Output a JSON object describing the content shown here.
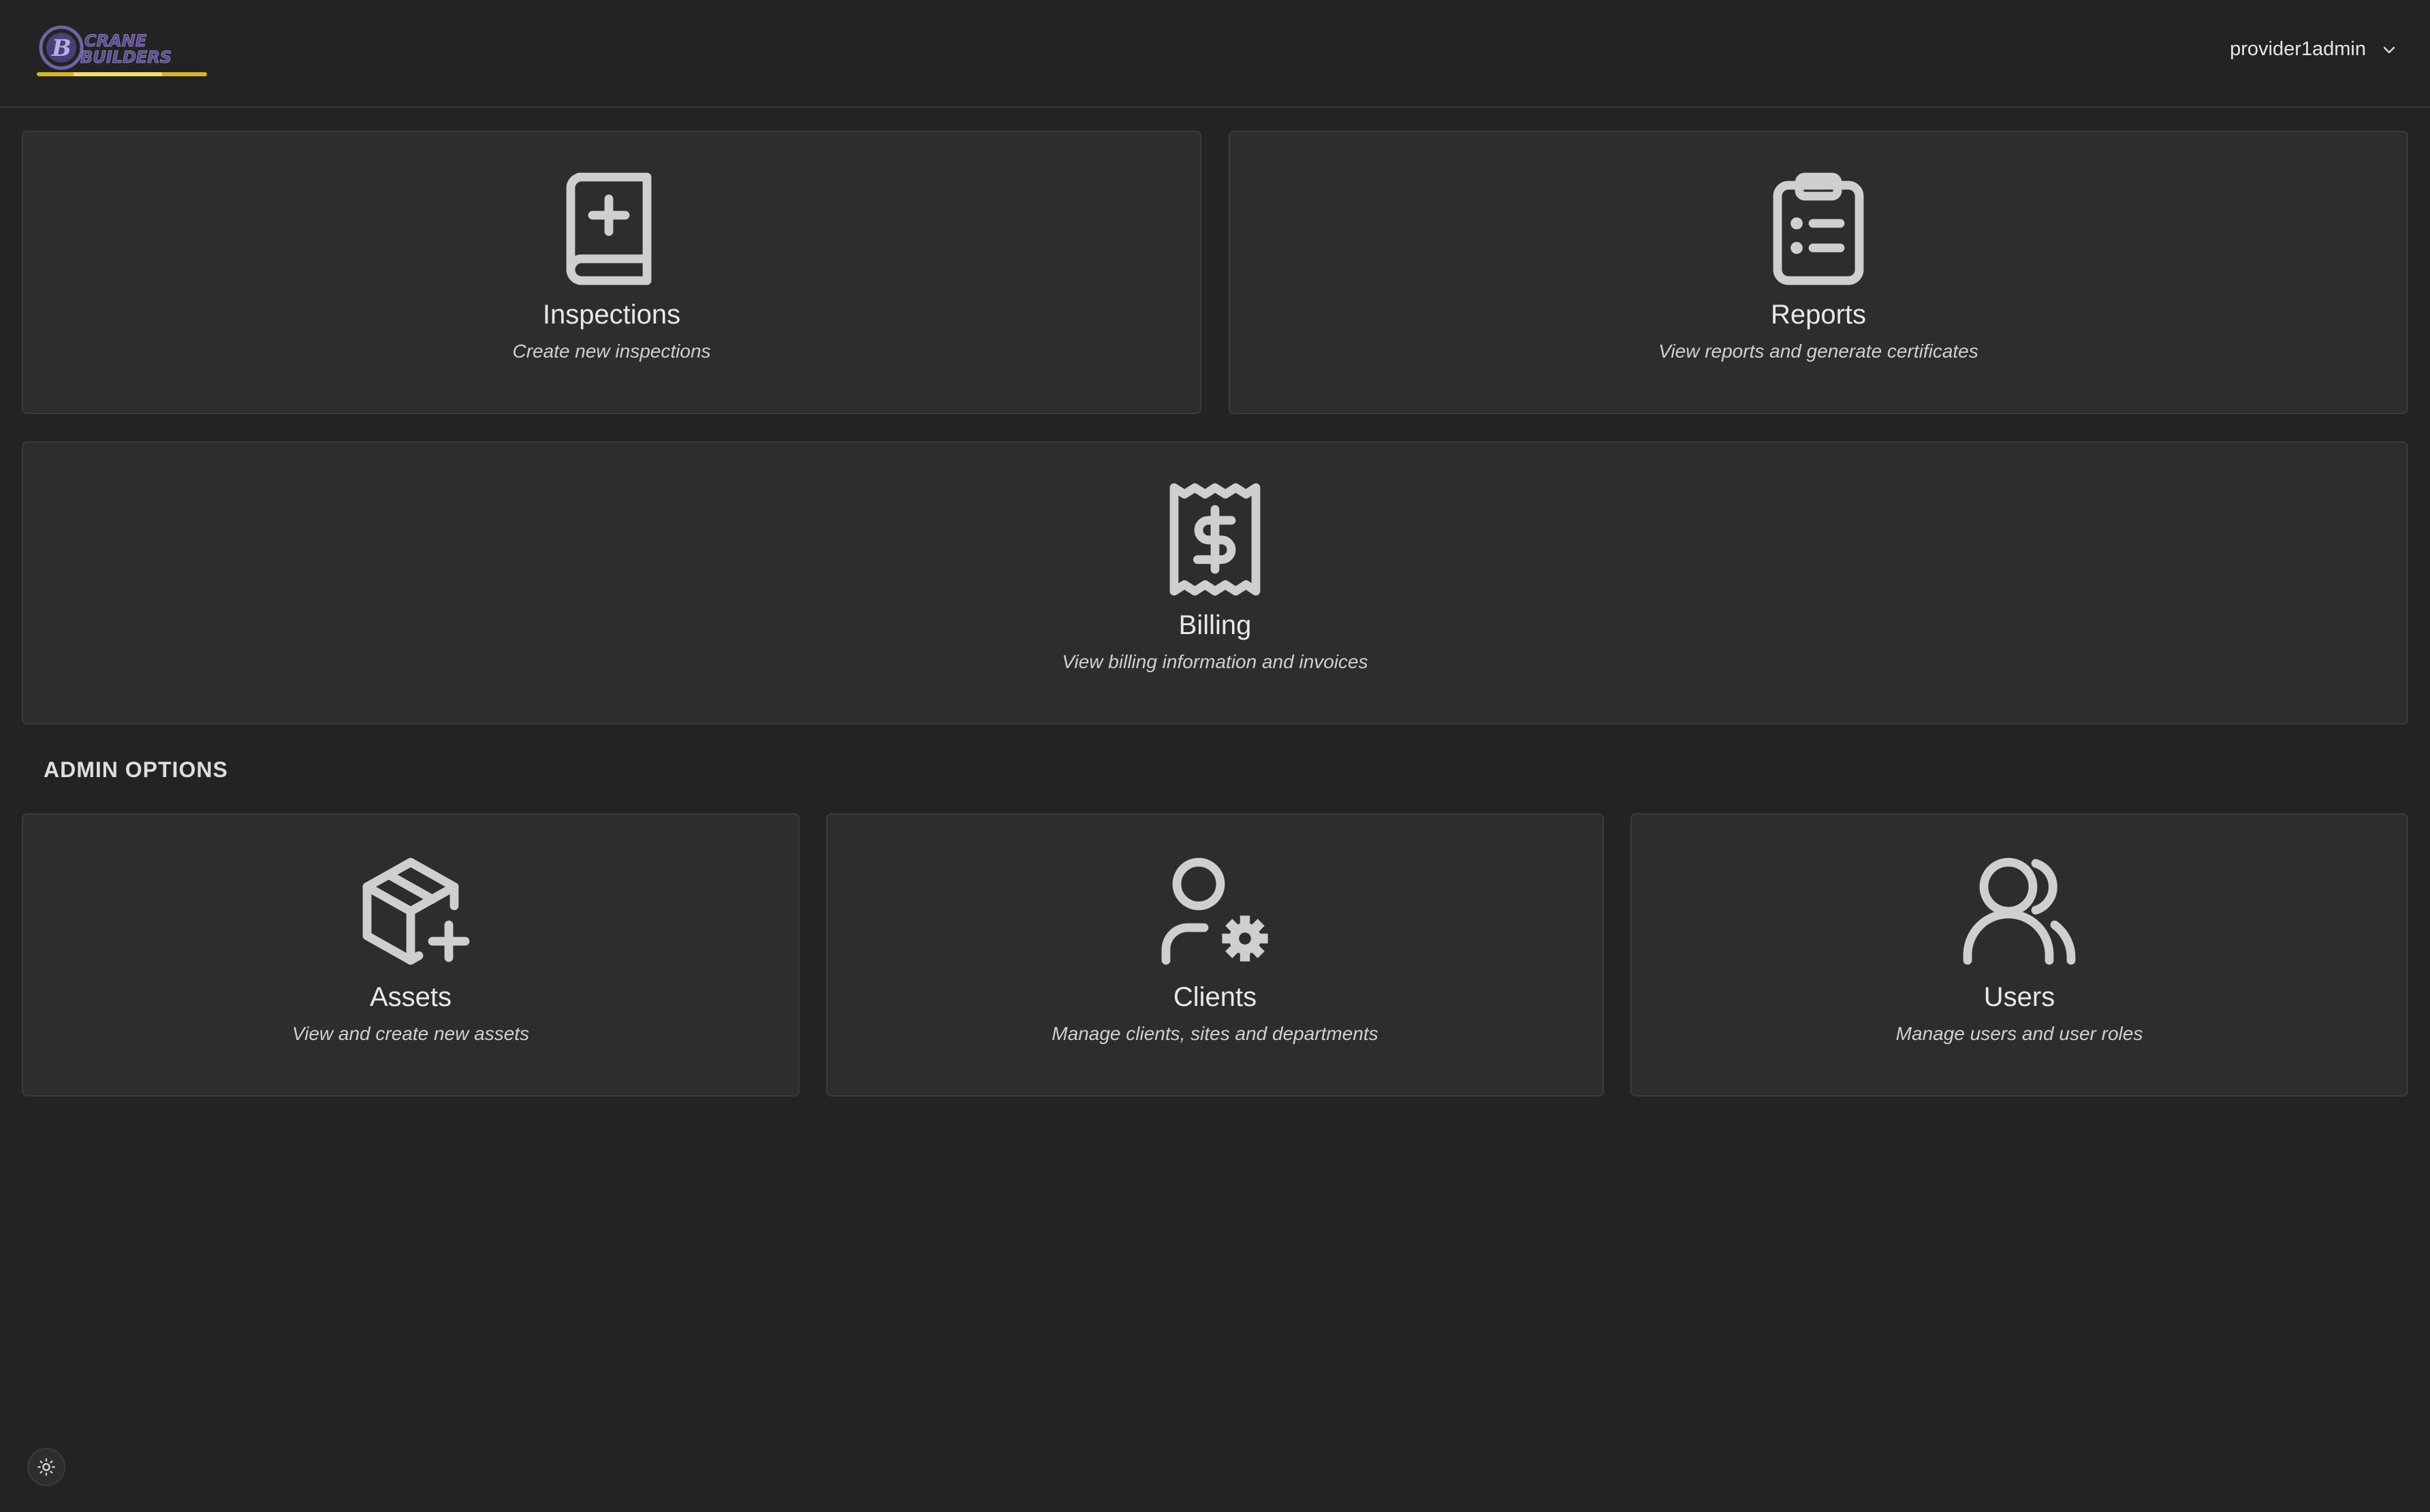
{
  "app": {
    "logo_text": "CRANE BUILDERS",
    "logo_icon": "cb-logo"
  },
  "header": {
    "username": "provider1admin",
    "user_menu_icon": "chevron-down-icon"
  },
  "cards": {
    "inspections": {
      "title": "Inspections",
      "description": "Create new inspections",
      "icon": "book-plus-icon"
    },
    "reports": {
      "title": "Reports",
      "description": "View reports and generate certificates",
      "icon": "clipboard-list-icon"
    },
    "billing": {
      "title": "Billing",
      "description": "View billing information and invoices",
      "icon": "receipt-dollar-icon"
    }
  },
  "admin": {
    "section_label": "ADMIN OPTIONS",
    "cards": {
      "assets": {
        "title": "Assets",
        "description": "View and create new assets",
        "icon": "package-plus-icon"
      },
      "clients": {
        "title": "Clients",
        "description": "Manage clients, sites and departments",
        "icon": "user-cog-icon"
      },
      "users": {
        "title": "Users",
        "description": "Manage users and user roles",
        "icon": "users-icon"
      }
    }
  },
  "footer": {
    "theme_toggle_icon": "sun-icon"
  },
  "colors": {
    "background": "#232323",
    "card": "#2d2d2d",
    "card_border": "#3c3c3c",
    "icon": "#cfcfcf",
    "logo_purple": "#5b4b8a",
    "logo_gold": "#d4b72a"
  }
}
